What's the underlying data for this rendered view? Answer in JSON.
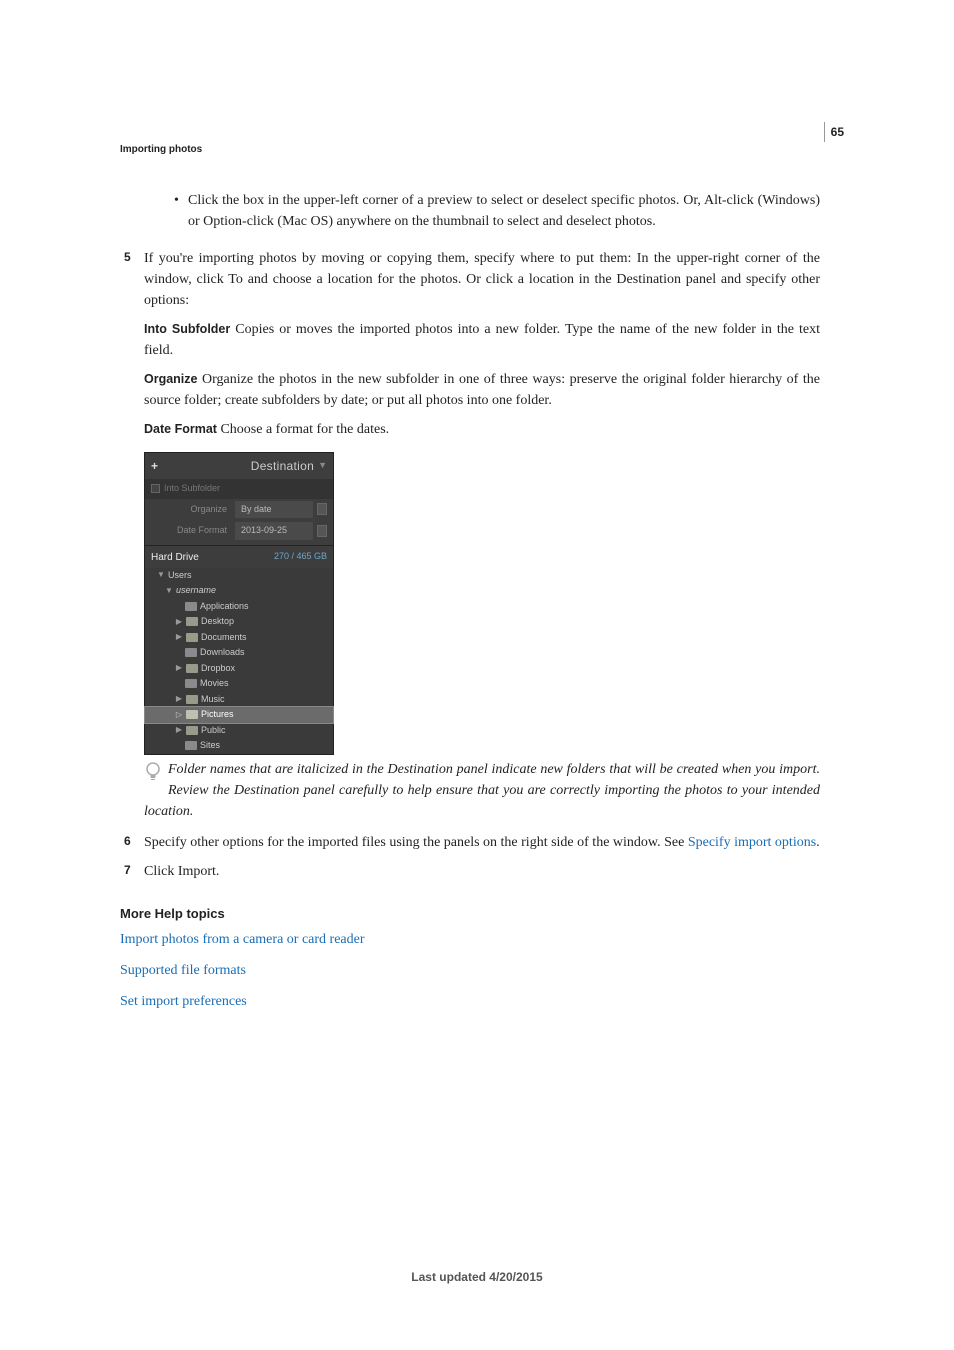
{
  "pageNumber": "65",
  "sectionHeader": "Importing photos",
  "bullet1": "Click the box in the upper-left corner of a preview to select or deselect specific photos. Or, Alt-click (Windows) or Option-click (Mac OS) anywhere on the thumbnail to select and deselect photos.",
  "step5": {
    "num": "5",
    "text": "If you're importing photos by moving or copying them, specify where to put them: In the upper-right corner of the window, click To and choose a location for the photos. Or click a location in the Destination panel and specify other options:"
  },
  "def1": {
    "label": "Into Subfolder",
    "text": "  Copies or moves the imported photos into a new folder. Type the name of the new folder in the text field."
  },
  "def2": {
    "label": "Organize",
    "text": "  Organize the photos in the new subfolder in one of three ways: preserve the original folder hierarchy of the source folder; create subfolders by date; or put all photos into one folder."
  },
  "def3": {
    "label": "Date Format",
    "text": "  Choose a format for the dates."
  },
  "panel": {
    "plus": "+",
    "title": "Destination",
    "tri": "▼",
    "subfolderLabel": "Into Subfolder",
    "organizeLabel": "Organize",
    "organizeValue": "By date",
    "dateFormatLabel": "Date Format",
    "dateFormatValue": "2013-09-25",
    "drive": "Hard Drive",
    "driveSize": "270 / 465 GB",
    "tree": {
      "users": "Users",
      "username": "username",
      "applications": "Applications",
      "desktop": "Desktop",
      "documents": "Documents",
      "downloads": "Downloads",
      "dropbox": "Dropbox",
      "movies": "Movies",
      "music": "Music",
      "pictures": "Pictures",
      "public": "Public",
      "sites": "Sites"
    }
  },
  "tipText": "Folder names that are italicized in the Destination panel indicate new folders that will be created when you import. Review the Destination panel carefully to help ensure that you are correctly importing the photos to your intended location.",
  "step6": {
    "num": "6",
    "textA": "Specify other options for the imported files using the panels on the right side of the window. See ",
    "link": "Specify import options",
    "textB": "."
  },
  "step7": {
    "num": "7",
    "text": "Click Import."
  },
  "moreHelp": {
    "heading": "More Help topics",
    "link1": "Import photos from a camera or card reader",
    "link2": "Supported file formats",
    "link3": "Set import preferences"
  },
  "footer": "Last updated 4/20/2015"
}
